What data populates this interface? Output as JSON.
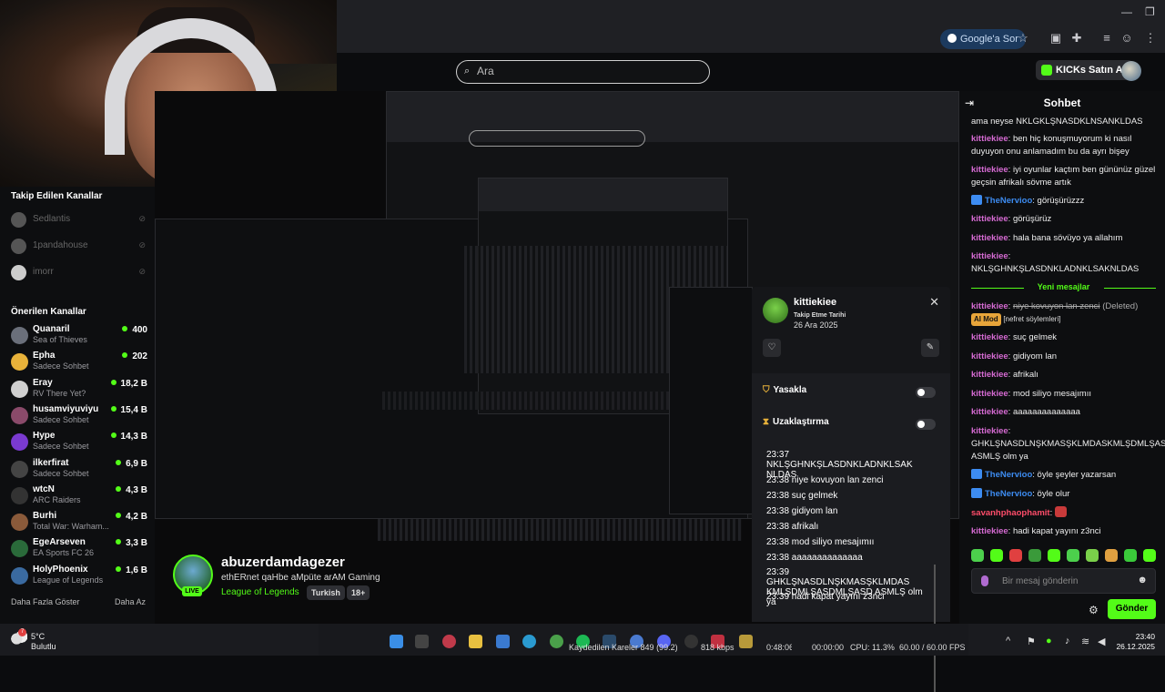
{
  "browser": {
    "google_sor_label": "Google'a Sor"
  },
  "header": {
    "search_placeholder": "Ara",
    "kicks_button_label": "KICKs Satın Al"
  },
  "sidebar": {
    "followed_title": "Takip Edilen Kanallar",
    "followed": [
      {
        "name": "Sedlantis"
      },
      {
        "name": "1pandahouse"
      },
      {
        "name": "imorr"
      }
    ],
    "recommended_title": "Önerilen Kanallar",
    "recommended": [
      {
        "name": "Quanaril",
        "category": "Sea of Thieves",
        "viewers": "400",
        "color": "#6a6f7a"
      },
      {
        "name": "Epha",
        "category": "Sadece Sohbet",
        "viewers": "202",
        "color": "#e8b23a"
      },
      {
        "name": "Eray",
        "category": "RV There Yet?",
        "viewers": "18,2 B",
        "color": "#d0d0d0"
      },
      {
        "name": "husamviyuviyu",
        "category": "Sadece Sohbet",
        "viewers": "15,4 B",
        "color": "#8a4a6a"
      },
      {
        "name": "Hype",
        "category": "Sadece Sohbet",
        "viewers": "14,3 B",
        "color": "#7a3ad0"
      },
      {
        "name": "ilkerfirat",
        "category": "Sadece Sohbet",
        "viewers": "6,9 B",
        "color": "#444"
      },
      {
        "name": "wtcN",
        "category": "ARC Raiders",
        "viewers": "4,3 B",
        "color": "#333"
      },
      {
        "name": "Burhi",
        "category": "Total War: Warham...",
        "viewers": "4,2 B",
        "color": "#8a5a3a"
      },
      {
        "name": "EgeArseven",
        "category": "EA Sports FC 26",
        "viewers": "3,3 B",
        "color": "#2a6a3a"
      },
      {
        "name": "HolyPhoenix",
        "category": "League of Legends",
        "viewers": "1,6 B",
        "color": "#3a6aa0"
      }
    ],
    "show_more": "Daha Fazla Göster",
    "show_less": "Daha Az"
  },
  "stream": {
    "streamer": "abuzerdamdagezer",
    "title": "ethERnet qaHbe aMpüte arAM Gaming",
    "category": "League of Legends",
    "tags": [
      "Turkish",
      "18+"
    ],
    "live_label": "LIVE"
  },
  "user_card": {
    "username": "kittiekiee",
    "follow_label": "Takip Etme Tarihi",
    "follow_date": "26 Ara 2025",
    "ban_label": "Yasakla",
    "timeout_label": "Uzaklaştırma",
    "log": [
      "23:37 NKLŞGHNKŞLASDNKLADNKLSAK NLDAS",
      "23:38 niye kovuyon lan zenci",
      "23:38 suç gelmek",
      "23:38 gidiyom lan",
      "23:38 afrikalı",
      "23:38 mod siliyo mesajımıı",
      "23:38 aaaaaaaaaaaaaa",
      "23:39 GHKLŞNASDLNŞKMASŞKLMDAS KMLŞDMLŞASDMLŞASD ASMLŞ olm ya",
      "23:39 hadi kapat yayını z3nci"
    ]
  },
  "chat": {
    "title": "Sohbet",
    "messages_top": [
      {
        "user": "",
        "text": "ama neyse NKLGKLŞNASDKLNSANKLDAS"
      },
      {
        "user": "kittiekiee",
        "text": "ben hiç konuşmuyorum ki nasıl duyuyon onu anlamadım bu da ayrı bişey"
      },
      {
        "user": "kittiekiee",
        "text": "iyi oyunlar kaçtım ben gününüz güzel geçsin afrikalı sövme artık"
      },
      {
        "user": "TheNervioo",
        "text": "görüşürüzzz",
        "verified": true
      },
      {
        "user": "kittiekiee",
        "text": "görüşürüz"
      },
      {
        "user": "kittiekiee",
        "text": "hala bana sövüyo ya allahım"
      },
      {
        "user": "kittiekiee",
        "text": "NKLŞGHNKŞLASDNKLADNKLSAKNLDAS"
      }
    ],
    "new_messages_label": "Yeni mesajlar",
    "deleted": {
      "user": "kittiekiee",
      "text": "niye kovuyon lan zenci",
      "deleted_label": "(Deleted)",
      "badge": "AI Mod",
      "reason": "[nefret söylemleri]"
    },
    "messages_bottom": [
      {
        "user": "kittiekiee",
        "text": "suç gelmek"
      },
      {
        "user": "kittiekiee",
        "text": "gidiyom lan"
      },
      {
        "user": "kittiekiee",
        "text": "afrikalı"
      },
      {
        "user": "kittiekiee",
        "text": "mod siliyo mesajımıı"
      },
      {
        "user": "kittiekiee",
        "text": "aaaaaaaaaaaaaa"
      },
      {
        "user": "kittiekiee",
        "text": "GHKLŞNASDLNŞKMASŞKLMDASKMLŞDMLŞASDMLŞASD ASMLŞ olm ya"
      },
      {
        "user": "TheNervioo",
        "text": "öyle şeyler yazarsan",
        "verified": true
      },
      {
        "user": "TheNervioo",
        "text": "öyle olur",
        "verified": true
      },
      {
        "user": "savanhphaophamit",
        "text": "",
        "emote": true
      },
      {
        "user": "kittiekiee",
        "text": "hadi kapat yayını z3nci"
      }
    ],
    "input_placeholder": "Bir mesaj gönderin",
    "send_label": "Gönder"
  },
  "taskbar": {
    "weather_temp": "5°C",
    "weather_cond": "Bulutlu",
    "weather_badge": "7",
    "obs_frames": "Kaydedilen Kareler 849 (99.2)",
    "obs_kbps": "818 kbps",
    "obs_time1": "0:48:06",
    "obs_time2": "00:00:00",
    "obs_cpu": "CPU: 11.3%",
    "obs_fps": "60.00 / 60.00 FPS",
    "clock": "23:40",
    "date": "26.12.2025"
  },
  "colors": {
    "kick_green": "#53fc18",
    "chat_user": "#d66bd3",
    "verified_blue": "#3d8cf1"
  }
}
